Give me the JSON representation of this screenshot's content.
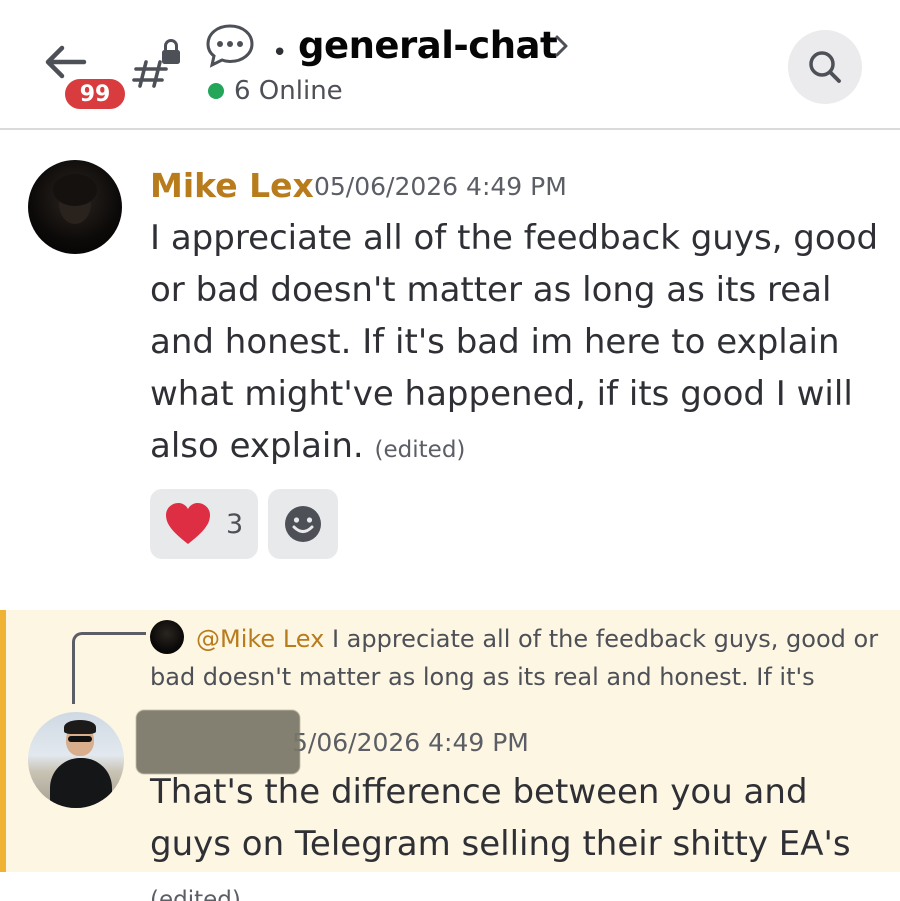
{
  "header": {
    "unread_count": "99",
    "separator": "•",
    "channel_name": "general-chat",
    "online_status": "6 Online",
    "icons": {
      "back": "back-arrow-icon",
      "channel": "locked-hash-icon",
      "thread": "chat-bubble-icon",
      "chevron": "chevron-right-icon",
      "search": "search-icon"
    }
  },
  "messages": [
    {
      "author": "Mike Lex",
      "author_color": "#b87c1c",
      "timestamp": "05/06/2026 4:49 PM",
      "content": "I appreciate all of the feedback guys, good or bad doesn't matter as long as its real and honest. If it's bad im here to explain what might've happened, if its good I will also explain.",
      "edited_label": "(edited)",
      "reactions": [
        {
          "emoji": "heart",
          "count": "3"
        }
      ],
      "add_reaction_icon": "add-reaction-icon"
    },
    {
      "reply": {
        "mention": "@Mike Lex",
        "preview": "I appreciate all of the feedback guys, good or bad doesn't matter as long as its real and honest. If it's"
      },
      "timestamp": "5/06/2026 4:49 PM",
      "content": "That's the difference between you and guys on Telegram selling their shitty EA's",
      "edited_label": "(edited)",
      "highlight_color": "#fdf6e3",
      "accent_color": "#f0b232"
    }
  ],
  "colors": {
    "badge_red": "#d83c3e",
    "online_green": "#23a55a"
  }
}
